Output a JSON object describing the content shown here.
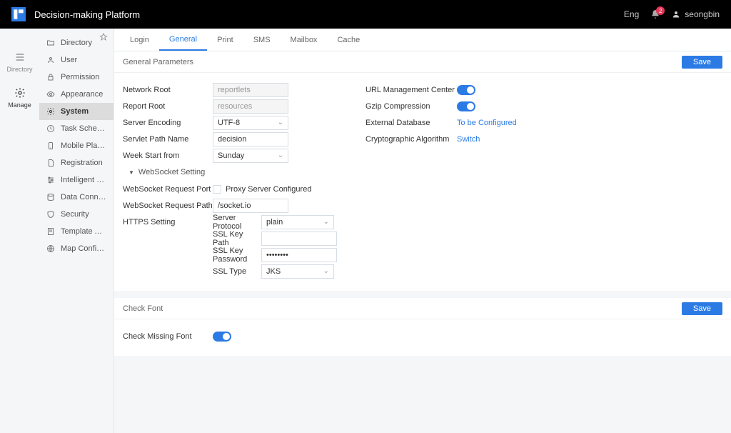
{
  "header": {
    "title": "Decision-making Platform",
    "lang": "Eng",
    "badge": "2",
    "user": "seongbin"
  },
  "rail": [
    {
      "label": "Directory"
    },
    {
      "label": "Manage"
    }
  ],
  "sidebar": [
    "Directory",
    "User",
    "Permission",
    "Appearance",
    "System",
    "Task Schedule",
    "Mobile Platform",
    "Registration",
    "Intelligent Operatio...",
    "Data Connection",
    "Security",
    "Template Authenti...",
    "Map Configuration"
  ],
  "tabs": [
    "Login",
    "General",
    "Print",
    "SMS",
    "Mailbox",
    "Cache"
  ],
  "buttons": {
    "save": "Save"
  },
  "general": {
    "title": "General Parameters",
    "network_root": {
      "label": "Network Root",
      "value": "reportlets"
    },
    "report_root": {
      "label": "Report Root",
      "value": "resources"
    },
    "server_encoding": {
      "label": "Server Encoding",
      "value": "UTF-8"
    },
    "servlet_path": {
      "label": "Servlet Path Name",
      "value": "decision"
    },
    "week_start": {
      "label": "Week Start from",
      "value": "Sunday"
    },
    "websocket": {
      "title": "WebSocket Setting",
      "port_label": "WebSocket Request Port",
      "proxy_label": "Proxy Server Configured",
      "path_label": "WebSocket Request Path",
      "path_value": "/socket.io"
    },
    "https": {
      "label": "HTTPS Setting",
      "protocol_label": "Server Protocol",
      "protocol_value": "plain",
      "keypath_label": "SSL Key Path",
      "keypass_label": "SSL Key Password",
      "keypass_value": "••••••••",
      "ssltype_label": "SSL Type",
      "ssltype_value": "JKS"
    },
    "right": {
      "url_mgmt": "URL Management Center",
      "gzip": "Gzip Compression",
      "ext_db": "External Database",
      "ext_db_value": "To be Configured",
      "crypto": "Cryptographic Algorithm",
      "crypto_value": "Switch"
    }
  },
  "font": {
    "title": "Check Font",
    "check_missing_label": "Check Missing Font"
  }
}
